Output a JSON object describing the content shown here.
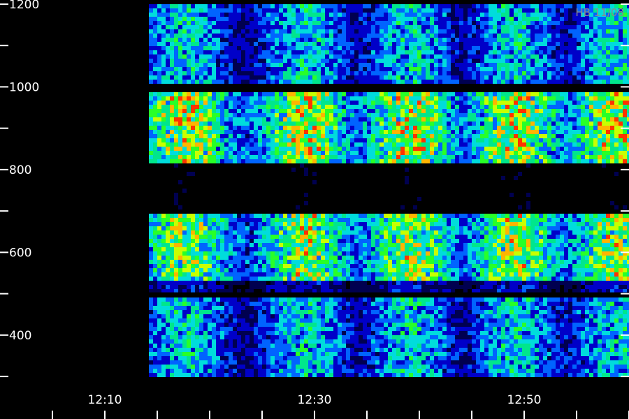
{
  "chart_data": {
    "type": "heatmap",
    "title": "",
    "xlabel": "",
    "ylabel": "",
    "stamp": "HB 11/08",
    "x_tick_labels": [
      "12:10",
      "12:30",
      "12:50"
    ],
    "x_tick_minutes": [
      10,
      30,
      50
    ],
    "x_minor_ticks_minutes": [
      5,
      10,
      15,
      20,
      25,
      30,
      35,
      40,
      45,
      50,
      55,
      60
    ],
    "xlim_minutes_after_12": [
      0,
      60
    ],
    "y_tick_labels": [
      "1200",
      "1000",
      "800",
      "600",
      "400"
    ],
    "y_tick_values": [
      1200,
      1000,
      800,
      600,
      400
    ],
    "y_minor_ticks": [
      1100,
      900,
      700,
      500,
      300
    ],
    "ylim": [
      290,
      1210
    ],
    "signal_start_minutes": 14.2,
    "horizontal_lines": [
      1000,
      500
    ],
    "intensity_bands": [
      {
        "f_min": 1010,
        "f_max": 1200,
        "level": 0.55
      },
      {
        "f_min": 820,
        "f_max": 990,
        "level": 0.85
      },
      {
        "f_min": 705,
        "f_max": 815,
        "level": 0.1
      },
      {
        "f_min": 540,
        "f_max": 700,
        "level": 0.8
      },
      {
        "f_min": 505,
        "f_max": 540,
        "level": 0.3
      },
      {
        "f_min": 300,
        "f_max": 495,
        "level": 0.55
      }
    ],
    "pulse_centers_minutes": [
      17.5,
      29,
      39,
      49,
      58.5
    ],
    "pulse_width_minutes": 4,
    "colormap": [
      "#000000",
      "#000050",
      "#0000c8",
      "#0064ff",
      "#00dcdc",
      "#00e68c",
      "#28ff28",
      "#c8ff00",
      "#ffb400",
      "#ff3200"
    ]
  }
}
